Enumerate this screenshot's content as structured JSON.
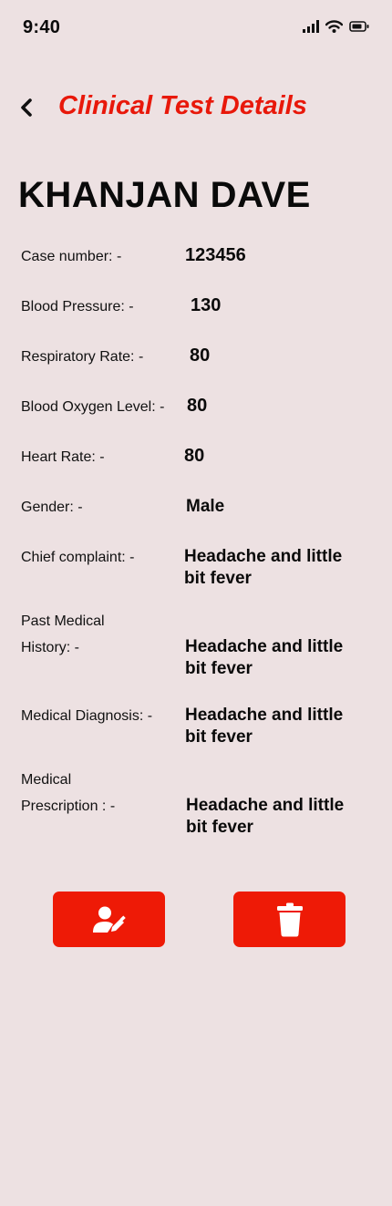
{
  "status_bar": {
    "time": "9:40"
  },
  "header": {
    "title": "Clinical Test Details"
  },
  "patient": {
    "name": "KHANJAN DAVE"
  },
  "details": {
    "case_number": {
      "label": "Case number: -",
      "value": "123456"
    },
    "blood_pressure": {
      "label": "Blood Pressure: -",
      "value": "130"
    },
    "respiratory_rate": {
      "label": "Respiratory Rate: -",
      "value": "80"
    },
    "blood_oxygen": {
      "label": "Blood Oxygen Level: -",
      "value": "80"
    },
    "heart_rate": {
      "label": "Heart Rate: -",
      "value": "80"
    },
    "gender": {
      "label": "Gender: -",
      "value": "Male"
    },
    "chief_complaint": {
      "label": "Chief complaint: -",
      "value": "Headache and little bit fever"
    },
    "past_medical_history": {
      "label_line1": "Past Medical",
      "label_line2": "History: -",
      "value": "Headache and little bit fever"
    },
    "medical_diagnosis": {
      "label": "Medical Diagnosis: -",
      "value": "Headache and little bit fever"
    },
    "medical_prescription": {
      "label_line1": "Medical",
      "label_line2": "Prescription : -",
      "value": "Headache and little bit fever"
    }
  },
  "actions": {
    "edit_icon": "user-edit-icon",
    "delete_icon": "trash-icon"
  },
  "colors": {
    "background": "#ede1e2",
    "accent": "#e8180a",
    "button": "#ee1a06",
    "text": "#0a0a0a"
  }
}
